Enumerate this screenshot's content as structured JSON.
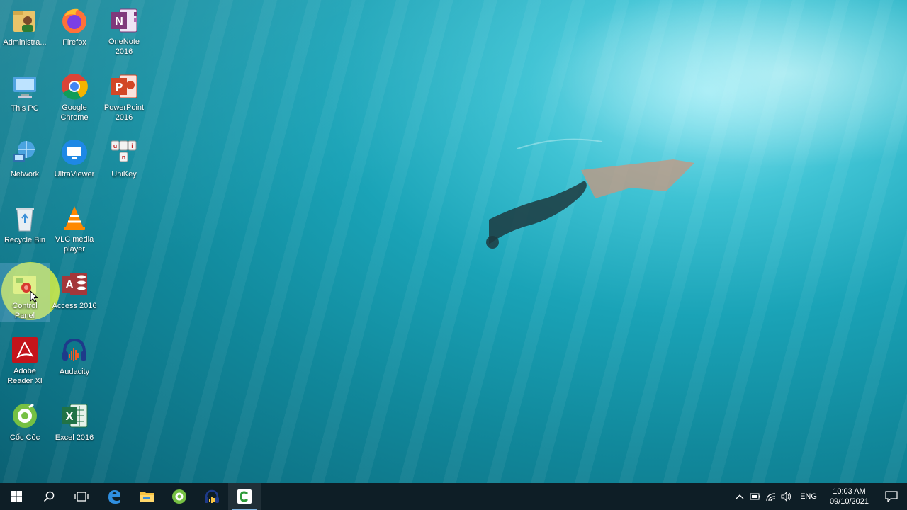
{
  "desktop": {
    "icons": [
      {
        "label": "Administra..."
      },
      {
        "label": "This PC"
      },
      {
        "label": "Network"
      },
      {
        "label": "Recycle Bin"
      },
      {
        "label": "Control\nPanel"
      },
      {
        "label": "Adobe\nReader XI"
      },
      {
        "label": "Cốc Cốc"
      },
      {
        "label": "Firefox"
      },
      {
        "label": "Google\nChrome"
      },
      {
        "label": "UltraViewer"
      },
      {
        "label": "VLC media\nplayer"
      },
      {
        "label": "Access 2016"
      },
      {
        "label": "Audacity"
      },
      {
        "label": "Excel 2016"
      },
      {
        "label": "OneNote\n2016"
      },
      {
        "label": "PowerPoint\n2016"
      },
      {
        "label": "UniKey"
      }
    ],
    "selected_icon": "Control Panel"
  },
  "taskbar": {
    "buttons": [
      "start",
      "search",
      "task-view",
      "edge",
      "file-explorer",
      "coc-coc",
      "audacity",
      "camtasia"
    ],
    "active_app": "camtasia"
  },
  "tray": {
    "language": "ENG",
    "time": "10:03 AM",
    "date": "09/10/2021"
  },
  "colors": {
    "taskbar": "#0e1e26",
    "accent": "#7fb4e0",
    "click_highlight": "#f0ff3c"
  }
}
